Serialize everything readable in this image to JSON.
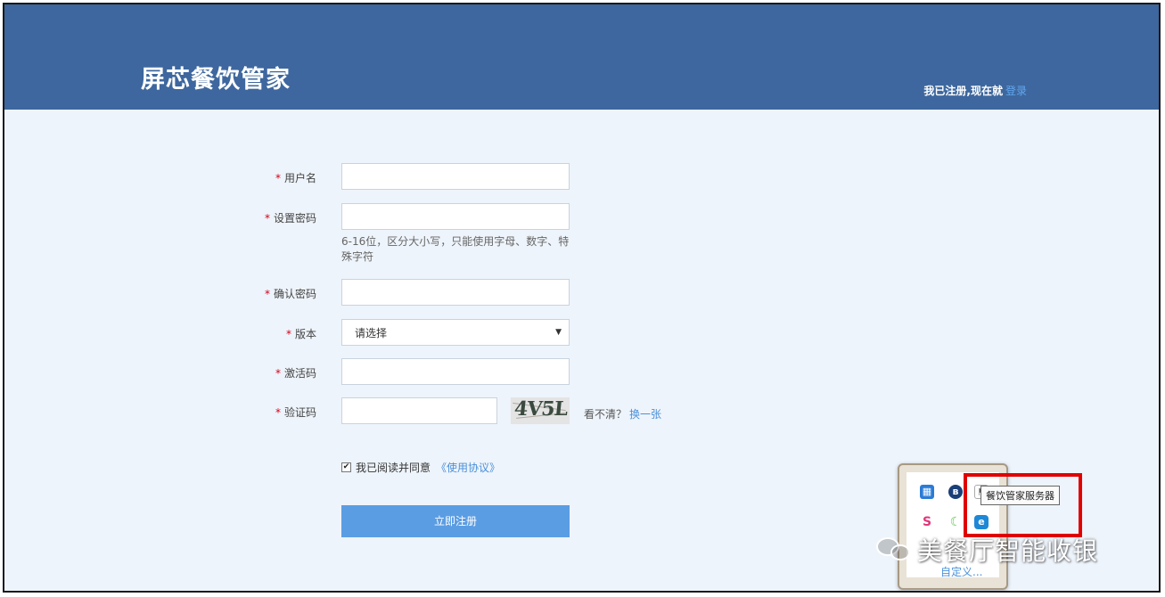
{
  "header": {
    "app_title": "屏芯餐饮管家",
    "login_hint": "我已注册,现在就",
    "login_link": "登录"
  },
  "form": {
    "required_mark": "*",
    "username": {
      "label": "用户名",
      "value": ""
    },
    "password": {
      "label": "设置密码",
      "value": "",
      "hint": "6-16位，区分大小写，只能使用字母、数字、特殊字符"
    },
    "confirm_password": {
      "label": "确认密码",
      "value": ""
    },
    "version": {
      "label": "版本",
      "selected": "请选择"
    },
    "activation_code": {
      "label": "激活码",
      "value": ""
    },
    "captcha": {
      "label": "验证码",
      "value": "",
      "image_text": "4V5L",
      "refresh_hint": "看不清？",
      "refresh_link": "换一张"
    },
    "agreement": {
      "checked": true,
      "text": "我已阅读并同意",
      "link": "《使用协议》"
    },
    "submit_label": "立即注册"
  },
  "tray": {
    "tooltip": "餐饮管家服务器",
    "customize_link": "自定义...",
    "icons": [
      "app-blue-icon",
      "bluetooth-icon",
      "flag-icon",
      "s-logo-icon",
      "green-moon-icon",
      "blue-service-icon"
    ],
    "highlight_color": "#e00000"
  },
  "watermark": {
    "text": "美餐厅智能收银"
  },
  "colors": {
    "header_bg": "#3d679e",
    "button_bg": "#5b9de3",
    "link": "#4a90d9",
    "required": "#d0021b"
  }
}
